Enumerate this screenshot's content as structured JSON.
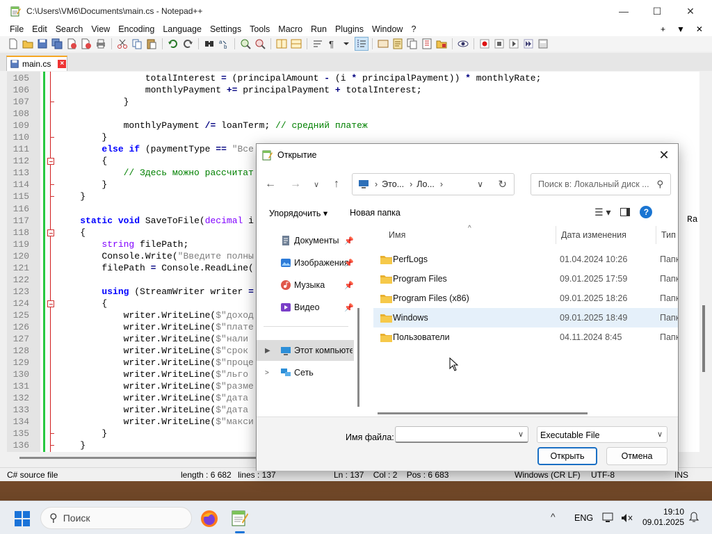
{
  "npp": {
    "title": "C:\\Users\\VM6\\Documents\\main.cs - Notepad++",
    "menu": [
      "File",
      "Edit",
      "Search",
      "View",
      "Encoding",
      "Language",
      "Settings",
      "Tools",
      "Macro",
      "Run",
      "Plugins",
      "Window",
      "?"
    ],
    "menu_right": [
      "+",
      "▼",
      "✕"
    ],
    "tab": {
      "label": "main.cs"
    },
    "status": {
      "filetype": "C# source file",
      "length": "length : 6 682",
      "lines": "lines : 137",
      "pos": "Ln : 137    Col : 2    Pos : 6 683",
      "eol": "Windows (CR LF)",
      "encoding": "UTF-8",
      "mode": "INS"
    },
    "right_edge_text": "Ra"
  },
  "code": [
    {
      "n": "105",
      "t": "                totalInterest = (principalAmount - (i * principalPayment)) * monthlyRate;"
    },
    {
      "n": "106",
      "t": "                monthlyPayment += principalPayment + totalInterest;"
    },
    {
      "n": "107",
      "t": "            }"
    },
    {
      "n": "108",
      "t": ""
    },
    {
      "n": "109",
      "t": "            monthlyPayment /= loanTerm; // средний платеж"
    },
    {
      "n": "110",
      "t": "        }"
    },
    {
      "n": "111",
      "t": "        else if (paymentType == \"Все"
    },
    {
      "n": "112",
      "t": "        {"
    },
    {
      "n": "113",
      "t": "            // Здесь можно рассчитат"
    },
    {
      "n": "114",
      "t": "        }"
    },
    {
      "n": "115",
      "t": "    }"
    },
    {
      "n": "116",
      "t": ""
    },
    {
      "n": "117",
      "t": "    static void SaveToFile(decimal i"
    },
    {
      "n": "118",
      "t": "    {"
    },
    {
      "n": "119",
      "t": "        string filePath;"
    },
    {
      "n": "120",
      "t": "        Console.Write(\"Введите полны"
    },
    {
      "n": "121",
      "t": "        filePath = Console.ReadLine("
    },
    {
      "n": "122",
      "t": ""
    },
    {
      "n": "123",
      "t": "        using (StreamWriter writer ="
    },
    {
      "n": "124",
      "t": "        {"
    },
    {
      "n": "125",
      "t": "            writer.WriteLine($\"доход"
    },
    {
      "n": "126",
      "t": "            writer.WriteLine($\"плате"
    },
    {
      "n": "127",
      "t": "            writer.WriteLine($\"нали"
    },
    {
      "n": "128",
      "t": "            writer.WriteLine($\"срок"
    },
    {
      "n": "129",
      "t": "            writer.WriteLine($\"проце"
    },
    {
      "n": "130",
      "t": "            writer.WriteLine($\"льго"
    },
    {
      "n": "131",
      "t": "            writer.WriteLine($\"разме"
    },
    {
      "n": "132",
      "t": "            writer.WriteLine($\"дата"
    },
    {
      "n": "133",
      "t": "            writer.WriteLine($\"дата"
    },
    {
      "n": "134",
      "t": "            writer.WriteLine($\"макси"
    },
    {
      "n": "135",
      "t": "        }"
    },
    {
      "n": "136",
      "t": "    }"
    }
  ],
  "dialog": {
    "title": "Открытие",
    "address": {
      "seg1": "Это...",
      "seg2": "Ло..."
    },
    "search_placeholder": "Поиск в: Локальный диск ...",
    "organize": "Упорядочить ▾",
    "new_folder": "Новая папка",
    "nav": [
      {
        "label": "Документы",
        "icon": "documents-icon",
        "pinned": true
      },
      {
        "label": "Изображения",
        "icon": "pictures-icon",
        "pinned": true
      },
      {
        "label": "Музыка",
        "icon": "music-icon",
        "pinned": true
      },
      {
        "label": "Видео",
        "icon": "video-icon",
        "pinned": true
      },
      {
        "label": "Этот компьютер",
        "icon": "this-pc-icon",
        "selected": true
      },
      {
        "label": "Сеть",
        "icon": "network-icon"
      }
    ],
    "columns": {
      "name": "Имя",
      "date": "Дата изменения",
      "type": "Тип"
    },
    "files": [
      {
        "name": "PerfLogs",
        "date": "01.04.2024 10:26",
        "type": "Папк"
      },
      {
        "name": "Program Files",
        "date": "09.01.2025 17:59",
        "type": "Папк"
      },
      {
        "name": "Program Files (x86)",
        "date": "09.01.2025 18:26",
        "type": "Папк"
      },
      {
        "name": "Windows",
        "date": "09.01.2025 18:49",
        "type": "Папк",
        "selected": true
      },
      {
        "name": "Пользователи",
        "date": "04.11.2024 8:45",
        "type": "Папк"
      }
    ],
    "filename_label": "Имя файла:",
    "filename_value": "",
    "filetype": "Executable File",
    "open_button": "Открыть",
    "cancel_button": "Отмена"
  },
  "taskbar": {
    "search_label": "Поиск",
    "lang": "ENG",
    "time": "19:10",
    "date": "09.01.2025"
  },
  "colors": {
    "accent": "#1a6fc4",
    "folder": "#f4c242",
    "fold_marker": "#d32020",
    "change_bar": "#26c840"
  }
}
